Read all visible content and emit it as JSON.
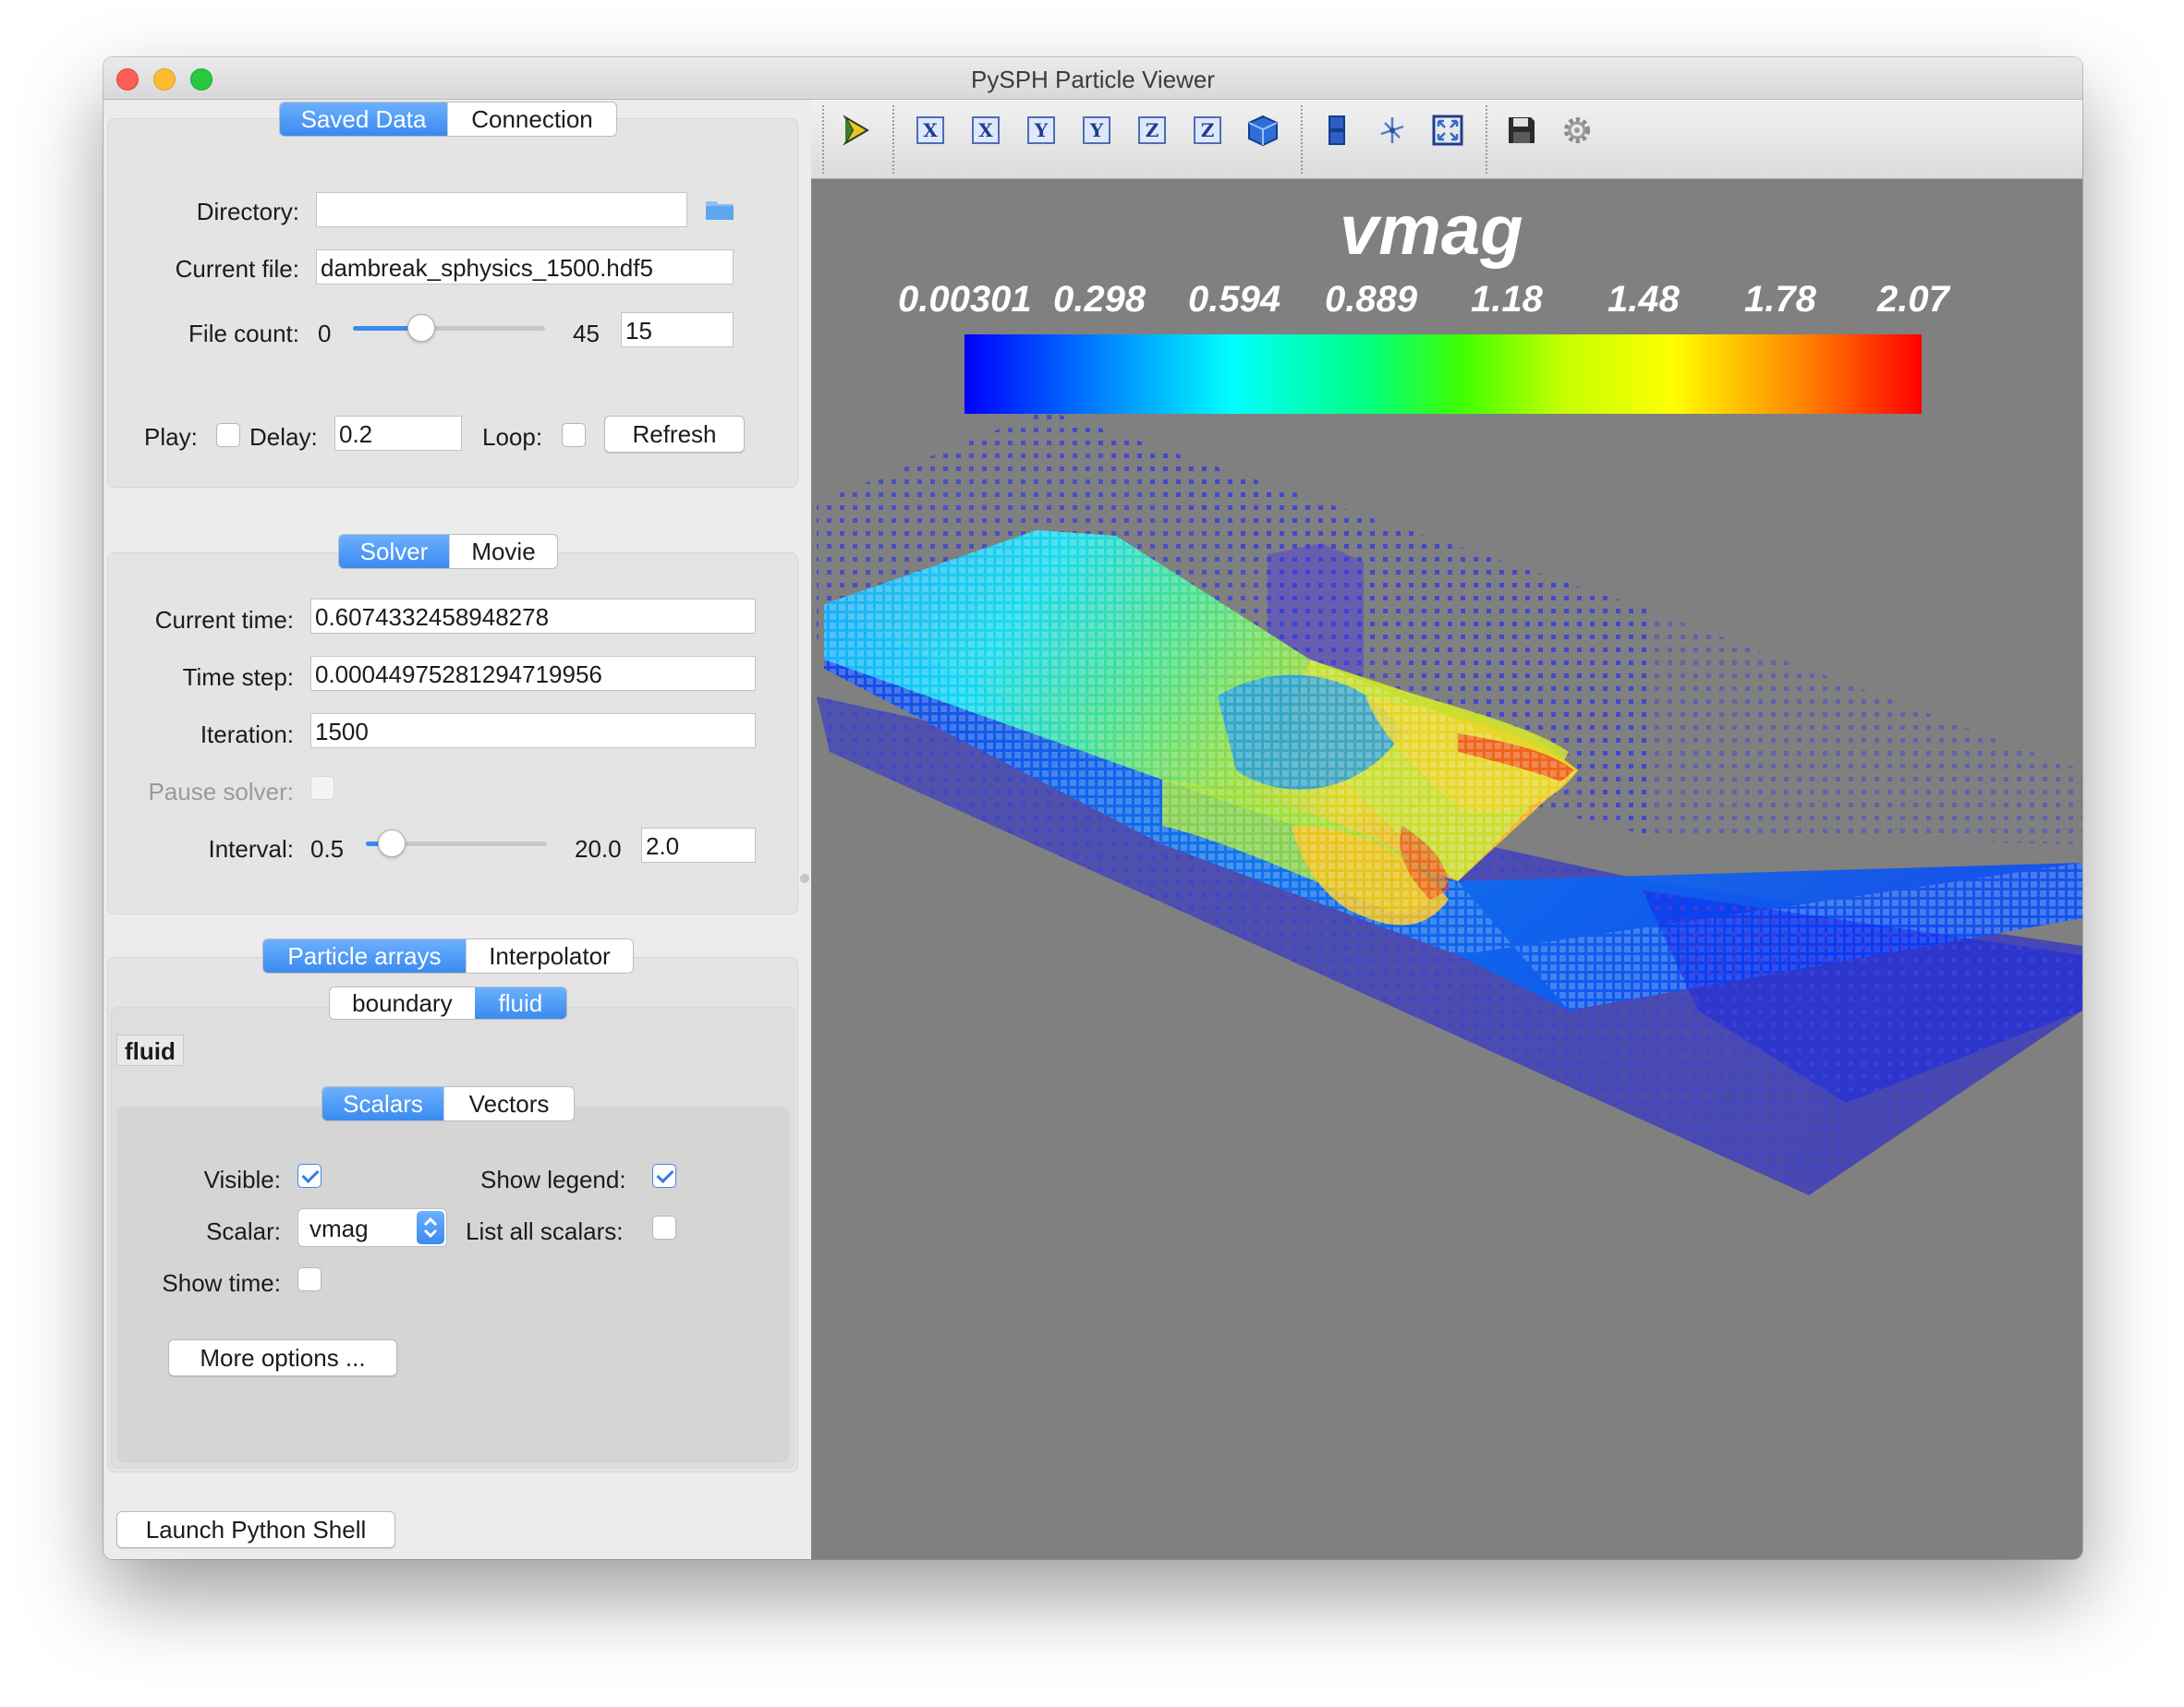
{
  "window": {
    "title": "PySPH Particle Viewer"
  },
  "data_tabs": {
    "active": "Saved Data",
    "other": "Connection"
  },
  "saved_data": {
    "directory_label": "Directory:",
    "directory_value": "",
    "current_file_label": "Current file:",
    "current_file_value": "dambreak_sphysics_1500.hdf5",
    "file_count_label": "File count:",
    "file_count_min": "0",
    "file_count_max": "45",
    "file_count_value": "15",
    "file_count_fraction": 0.333,
    "play_label": "Play:",
    "play_checked": false,
    "delay_label": "Delay:",
    "delay_value": "0.2",
    "loop_label": "Loop:",
    "loop_checked": false,
    "refresh_label": "Refresh"
  },
  "solver_tabs": {
    "active": "Solver",
    "other": "Movie"
  },
  "solver": {
    "current_time_label": "Current time:",
    "current_time_value": "0.6074332458948278",
    "time_step_label": "Time step:",
    "time_step_value": "0.00044975281294719956",
    "iteration_label": "Iteration:",
    "iteration_value": "1500",
    "pause_label": "Pause solver:",
    "interval_label": "Interval:",
    "interval_min": "0.5",
    "interval_max": "20.0",
    "interval_value": "2.0",
    "interval_fraction": 0.077
  },
  "array_tabs": {
    "active": "Particle arrays",
    "other": "Interpolator"
  },
  "array_subtabs": {
    "first": "boundary",
    "active": "fluid"
  },
  "array_name": "fluid",
  "scalar_tabs": {
    "active": "Scalars",
    "other": "Vectors"
  },
  "scalars": {
    "visible_label": "Visible:",
    "visible_checked": true,
    "show_legend_label": "Show legend:",
    "show_legend_checked": true,
    "scalar_label": "Scalar:",
    "scalar_value": "vmag",
    "list_all_label": "List all scalars:",
    "list_all_checked": false,
    "show_time_label": "Show time:",
    "show_time_checked": false,
    "more_options_label": "More options ..."
  },
  "launch_shell_label": "Launch Python Shell",
  "toolbar": {
    "icons": [
      "select-icon",
      "view-plus-x-icon",
      "view-minus-x-icon",
      "view-plus-y-icon",
      "view-minus-y-icon",
      "view-plus-z-icon",
      "view-minus-z-icon",
      "isometric-view-icon",
      "parallel-projection-icon",
      "axes-toggle-icon",
      "fullscreen-icon",
      "save-icon",
      "settings-icon"
    ],
    "axis_letters": [
      "X",
      "X",
      "Y",
      "Y",
      "Z",
      "Z"
    ]
  },
  "scene": {
    "scalar_title": "vmag",
    "colorbar_ticks": [
      "0.00301",
      "0.298",
      "0.594",
      "0.889",
      "1.18",
      "1.48",
      "1.78",
      "2.07"
    ],
    "colormap": [
      "#0000ff",
      "#00ffff",
      "#00ff00",
      "#ffff00",
      "#ff0000"
    ],
    "background_color": "#808080"
  }
}
